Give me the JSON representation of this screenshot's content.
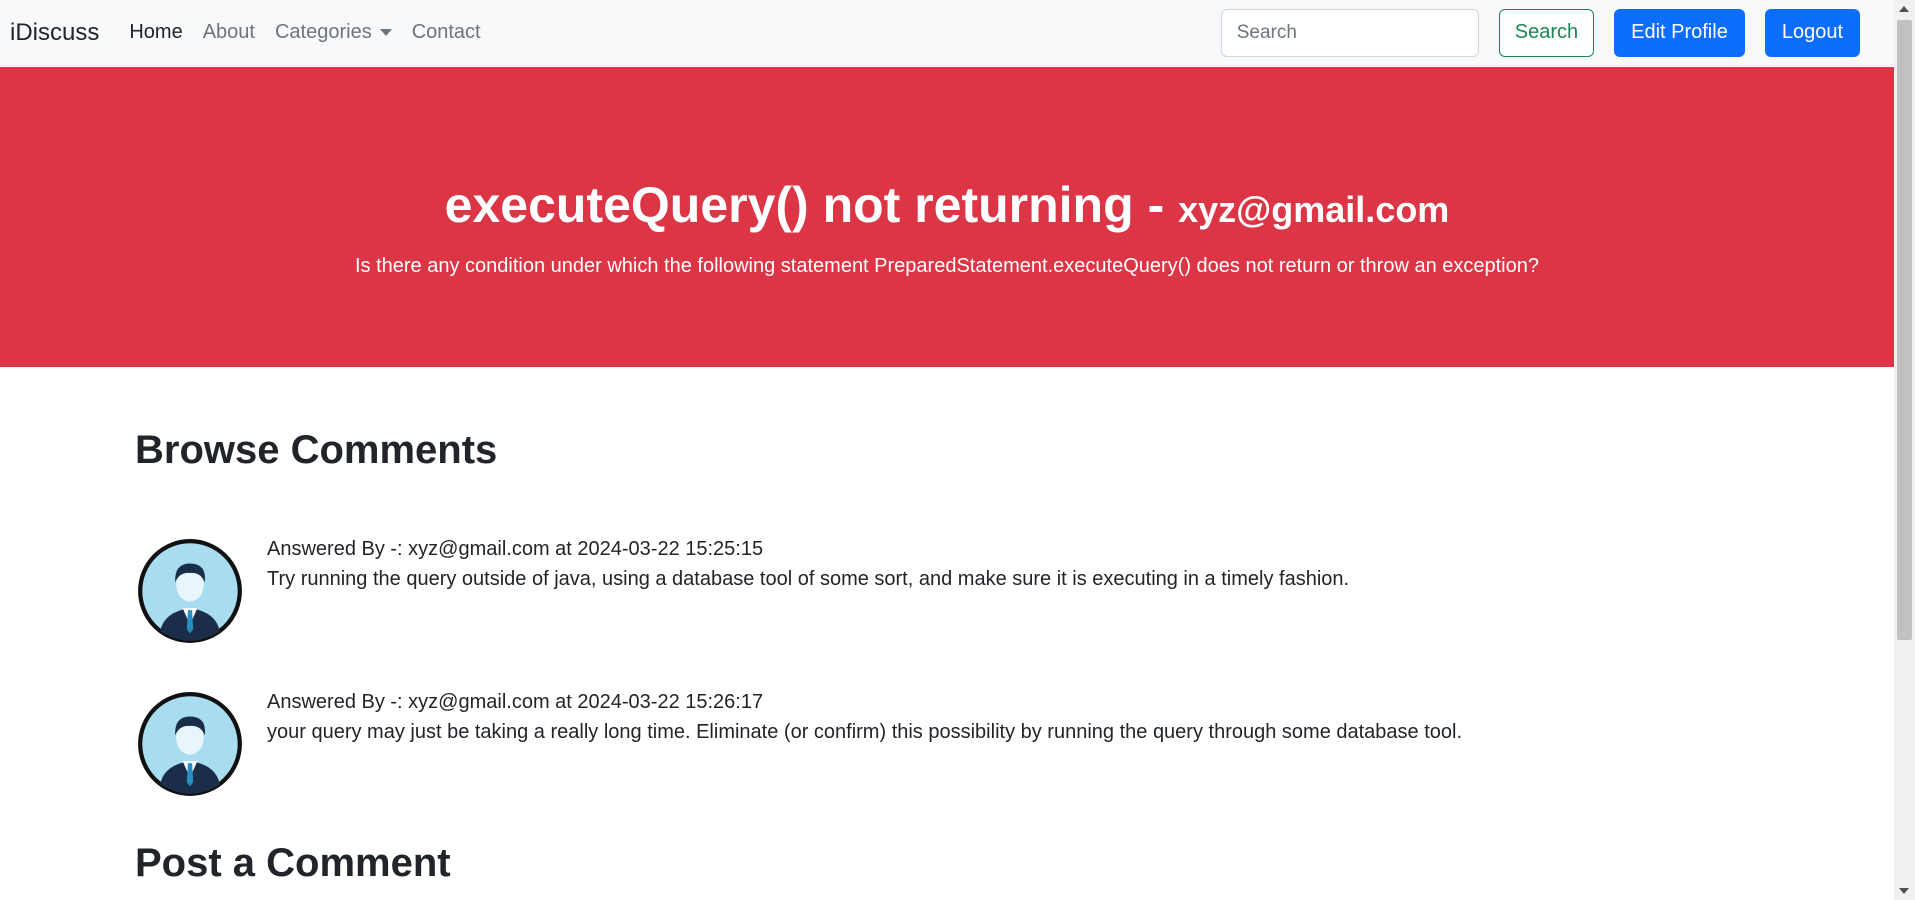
{
  "navbar": {
    "brand": "iDiscuss",
    "links": [
      {
        "label": "Home",
        "active": true
      },
      {
        "label": "About"
      },
      {
        "label": "Categories",
        "dropdown": true
      },
      {
        "label": "Contact"
      }
    ],
    "search_placeholder": "Search",
    "search_button": "Search",
    "edit_profile": "Edit Profile",
    "logout": "Logout"
  },
  "thread": {
    "title": "executeQuery() not returning",
    "separator": "-",
    "author": "xyz@gmail.com",
    "description": "Is there any condition under which the following statement PreparedStatement.executeQuery() does not return or throw an exception?"
  },
  "comments_section": {
    "title": "Browse Comments",
    "comments": [
      {
        "meta": "Answered By -: xyz@gmail.com at 2024-03-22 15:25:15",
        "text": "Try running the query outside of java, using a database tool of some sort, and make sure it is executing in a timely fashion.",
        "avatar": "user-avatar-icon"
      },
      {
        "meta": "Answered By -: xyz@gmail.com at 2024-03-22 15:26:17",
        "text": "your query may just be taking a really long time. Eliminate (or confirm) this possibility by running the query through some database tool.",
        "avatar": "user-avatar-icon"
      }
    ]
  },
  "post_section": {
    "title": "Post a Comment"
  },
  "colors": {
    "hero_bg": "#dc3545",
    "primary": "#0d6efd",
    "success": "#198754",
    "navbar_bg": "#f8f9fa"
  }
}
